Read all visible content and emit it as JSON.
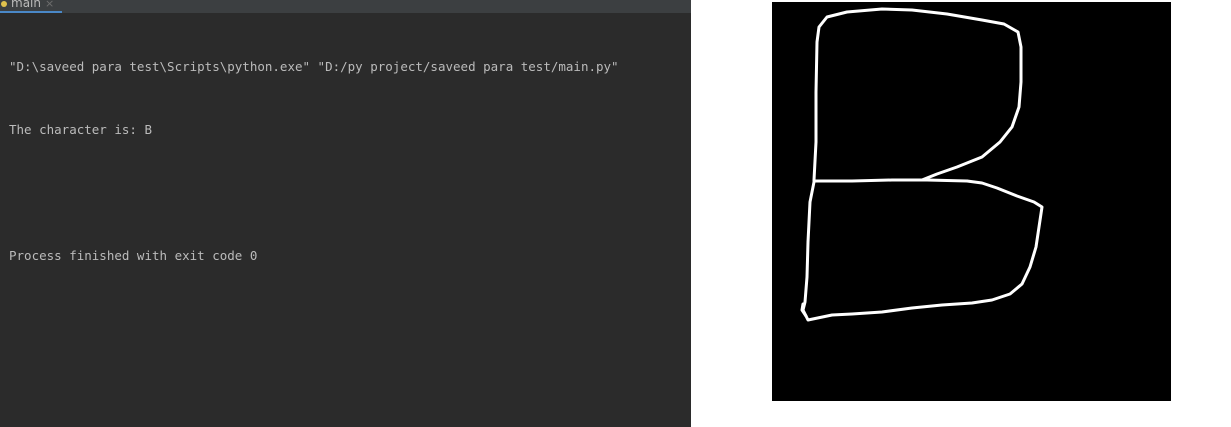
{
  "run_tab": {
    "label": "main",
    "close_glyph": "×",
    "icon": "python-file-icon"
  },
  "console": {
    "command_line": "\"D:\\saveed para test\\Scripts\\python.exe\" \"D:/py project/saveed para test/main.py\"",
    "result_line": "The character is: B",
    "exit_line": "Process finished with exit code 0"
  },
  "preview_image": {
    "description_role": "handwritten-character-image",
    "background": "#000000",
    "stroke": "#ffffff"
  },
  "colors": {
    "console_bg": "#2b2b2b",
    "console_text": "#bbbbbb",
    "tab_accent": "#4a88c7"
  }
}
